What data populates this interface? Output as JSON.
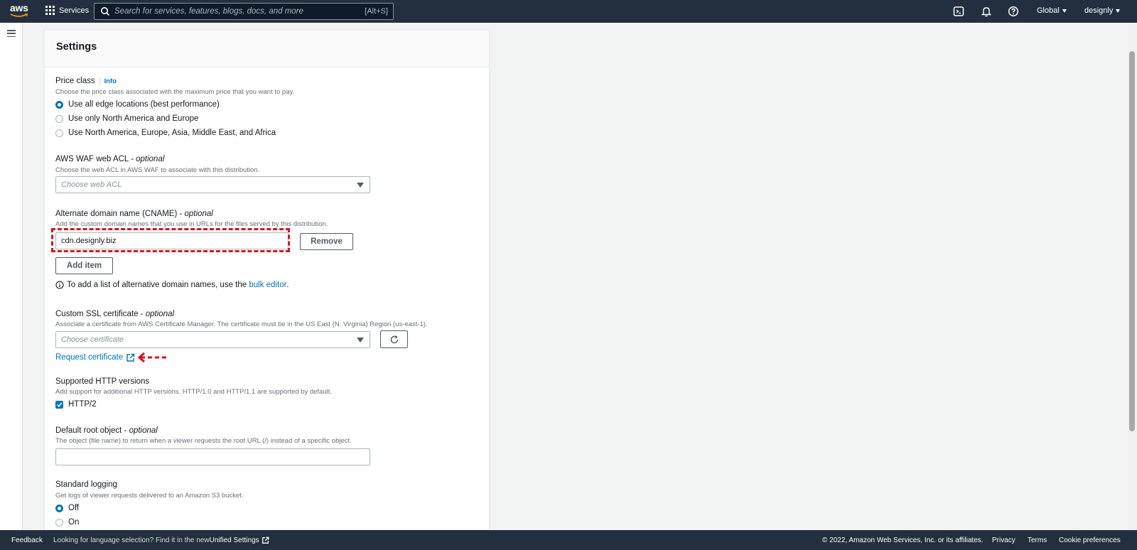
{
  "topnav": {
    "logo_text": "aws",
    "services_label": "Services",
    "search_placeholder": "Search for services, features, blogs, docs, and more",
    "search_shortcut": "[Alt+S]",
    "region_label": "Global",
    "account_label": "designly"
  },
  "settings": {
    "title": "Settings",
    "price_class": {
      "label": "Price class",
      "info": "Info",
      "description": "Choose the price class associated with the maximum price that you want to pay.",
      "options": [
        "Use all edge locations (best performance)",
        "Use only North America and Europe",
        "Use North America, Europe, Asia, Middle East, and Africa"
      ],
      "selected": 0
    },
    "waf": {
      "label": "AWS WAF web ACL - ",
      "label_optional": "optional",
      "description": "Choose the web ACL in AWS WAF to associate with this distribution.",
      "placeholder": "Choose web ACL"
    },
    "cname": {
      "label": "Alternate domain name (CNAME) - ",
      "label_optional": "optional",
      "description": "Add the custom domain names that you use in URLs for the files served by this distribution.",
      "value": "cdn.designly.biz",
      "remove_label": "Remove",
      "add_item_label": "Add item",
      "hint_prefix": "To add a list of alternative domain names, use the ",
      "hint_link": "bulk editor",
      "hint_suffix": "."
    },
    "ssl": {
      "label": "Custom SSL certificate - ",
      "label_optional": "optional",
      "description": "Associate a certificate from AWS Certificate Manager. The certificate must be in the US East (N. Virginia) Region (us-east-1).",
      "placeholder": "Choose certificate",
      "request_link": "Request certificate"
    },
    "http_versions": {
      "label": "Supported HTTP versions",
      "description": "Add support for additional HTTP versions. HTTP/1.0 and HTTP/1.1 are supported by default.",
      "option": "HTTP/2",
      "checked": true
    },
    "root_object": {
      "label": "Default root object - ",
      "label_optional": "optional",
      "description": "The object (file name) to return when a viewer requests the root URL (/) instead of a specific object.",
      "value": ""
    },
    "logging": {
      "label": "Standard logging",
      "description": "Get logs of viewer requests delivered to an Amazon S3 bucket.",
      "options": [
        "Off",
        "On"
      ],
      "selected": 0
    }
  },
  "footer": {
    "feedback": "Feedback",
    "language_text": "Looking for language selection? Find it in the new ",
    "unified_settings": "Unified Settings",
    "copyright": "© 2022, Amazon Web Services, Inc. or its affiliates.",
    "privacy": "Privacy",
    "terms": "Terms",
    "cookie": "Cookie preferences"
  },
  "colors": {
    "nav_bg": "#232f3e",
    "link": "#0073bb",
    "annotation_red": "#d9141b"
  },
  "icons": [
    "grid-icon",
    "search-icon",
    "cloudshell-icon",
    "bell-icon",
    "help-icon",
    "hamburger-icon",
    "info-icon",
    "refresh-icon",
    "external-link-icon",
    "checkmark-icon"
  ]
}
